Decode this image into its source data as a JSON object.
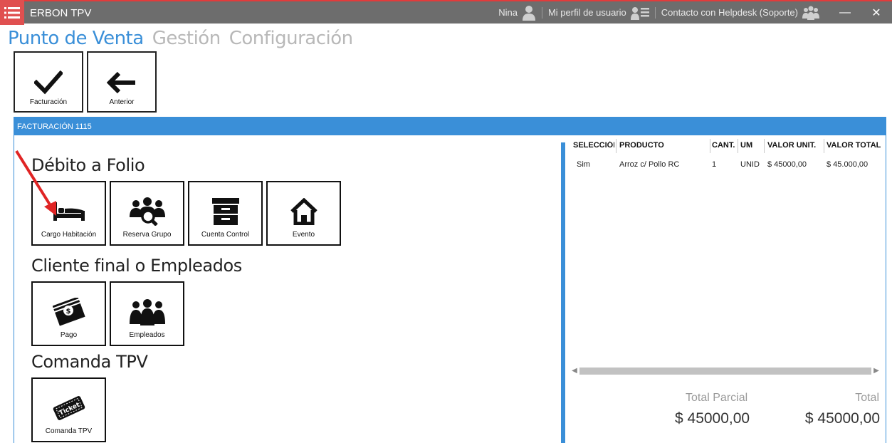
{
  "window": {
    "title": "ERBON TPV",
    "user_name": "Nina",
    "profile_label": "Mi perfil de usuario",
    "helpdesk_label": "Contacto con Helpdesk (Soporte)",
    "minimize_symbol": "—",
    "close_symbol": "✕"
  },
  "nav": {
    "tabs": [
      {
        "label": "Punto de Venta",
        "active": true
      },
      {
        "label": "Gestión",
        "active": false
      },
      {
        "label": "Configuración",
        "active": false
      }
    ]
  },
  "toolbar": {
    "facturacion_label": "Facturación",
    "anterior_label": "Anterior"
  },
  "panel": {
    "title": "FACTURACIÓN 1115"
  },
  "sections": {
    "debito": {
      "title": "Débito a Folio",
      "tiles": [
        "Cargo Habitación",
        "Reserva Grupo",
        "Cuenta Control",
        "Evento"
      ]
    },
    "cliente": {
      "title": "Cliente final o Empleados",
      "tiles": [
        "Pago",
        "Empleados"
      ]
    },
    "comanda": {
      "title": "Comanda TPV",
      "tiles": [
        "Comanda TPV"
      ],
      "ticket_text": "Ticket"
    }
  },
  "table": {
    "columns": [
      "SELECCIÓN",
      "PRODUCTO",
      "CANT.",
      "UM",
      "VALOR UNIT.",
      "VALOR TOTAL"
    ],
    "rows": [
      [
        "Sim",
        "Arroz c/ Pollo RC",
        "1",
        "UNID",
        "$ 45000,00",
        "$ 45.000,00"
      ]
    ]
  },
  "totals": {
    "parcial_label": "Total Parcial",
    "parcial_value": "$ 45000,00",
    "total_label": "Total",
    "total_value": "$ 45000,00"
  },
  "colors": {
    "accent": "#3a8fd8",
    "titlebar": "#6d6d6d",
    "menu_button": "#e05050",
    "annotation_arrow": "#e02424"
  },
  "icons": {
    "menu": "hamburger-list-icon",
    "user": "user-icon",
    "profile": "profile-card-icon",
    "helpdesk": "group-icon",
    "facturacion": "checkmark-icon",
    "anterior": "arrow-left-icon",
    "cargo_habitacion": "bed-icon",
    "reserva_grupo": "group-search-icon",
    "cuenta_control": "cabinet-icon",
    "evento": "house-icon",
    "pago": "money-icon",
    "empleados": "people-icon",
    "comanda_tpv": "ticket-icon"
  }
}
